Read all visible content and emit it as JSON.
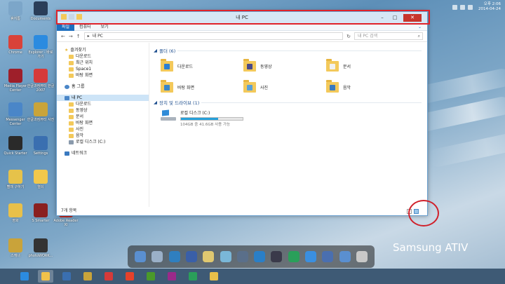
{
  "desktop": {
    "icons": [
      {
        "label": "휴지통",
        "color": "#7ca6c9"
      },
      {
        "label": "Documents",
        "color": "#2a3e59"
      },
      {
        "label": "Chrome",
        "color": "#d9423a"
      },
      {
        "label": "Explorer - 바로 가기",
        "color": "#2b8be0"
      },
      {
        "label": "Media Player Center",
        "color": "#9e1f2a"
      },
      {
        "label": "한글과컴퓨터 한글 2007",
        "color": "#d63a3a"
      },
      {
        "label": "Messenger Center",
        "color": "#4a86c8"
      },
      {
        "label": "한글과컴퓨터 사전",
        "color": "#c9a43a"
      },
      {
        "label": "Quick Starter",
        "color": "#2a2a2a"
      },
      {
        "label": "Settings",
        "color": "#3a6fb0"
      },
      {
        "label": "빨래 구하기",
        "color": "#e6c24a"
      },
      {
        "label": "열쇠",
        "color": "#f2c84b"
      },
      {
        "label": "영화",
        "color": "#e8c04a"
      },
      {
        "label": "S Smarter",
        "color": "#8a2020"
      },
      {
        "label": "Adobe Reader XI",
        "color": "#c3281e"
      },
      {
        "label": "스캐너",
        "color": "#c9a33a"
      },
      {
        "label": "photoWORK...",
        "color": "#333333"
      }
    ]
  },
  "window": {
    "title": "내 PC",
    "tabs": [
      "파일",
      "컴퓨터",
      "보기"
    ],
    "address": [
      "▸",
      "내 PC"
    ],
    "search_placeholder": "내 PC 검색",
    "nav": {
      "favorites_header": "즐겨찾기",
      "favorites": [
        "다운로드",
        "최근 위치",
        "Space1",
        "바탕 화면"
      ],
      "homegroup": "홈 그룹",
      "thispc": "내 PC",
      "thispc_items": [
        "다운로드",
        "동영상",
        "문서",
        "바탕 화면",
        "사진",
        "음악",
        "로컬 디스크 (C:)"
      ],
      "network": "네트워크"
    },
    "folders_header": "폴더 (6)",
    "folders": [
      {
        "label": "다운로드",
        "overlay": "#2b7fd4"
      },
      {
        "label": "동영상",
        "overlay": "#4a4a8a"
      },
      {
        "label": "문서",
        "overlay": "#f1f1f1"
      },
      {
        "label": "바탕 화면",
        "overlay": "#3a86c8"
      },
      {
        "label": "사진",
        "overlay": "#5aa0d8"
      },
      {
        "label": "음악",
        "overlay": "#3a7ac0"
      }
    ],
    "drives_header": "장치 및 드라이브 (1)",
    "drive": {
      "name": "로컬 디스크 (C:)",
      "size_text": "104GB 중 41.6GB 사용 가능",
      "used_fraction": 0.6
    },
    "status": "7개 항목"
  },
  "dock_colors": [
    "#5a8fd0",
    "#9ab0c8",
    "#2f7fbf",
    "#3a5fa8",
    "#e0c870",
    "#7ab7d8",
    "#5a6f8a",
    "#2a7fc7",
    "#3a3a4a",
    "#2a9f5a",
    "#3a8fe0",
    "#4a6fb0",
    "#5a8fd0",
    "#c8c8c8"
  ],
  "brand": "Samsung ATIV",
  "taskbar_colors": [
    "#2b8be0",
    "#f1c24a",
    "#3a6fb0",
    "#c9a43a",
    "#d63a3a",
    "#e6412b",
    "#4a9a2a",
    "#9a2a8a",
    "#2a9f5a",
    "#e8c04a"
  ],
  "clock": {
    "time": "오후 2:06",
    "date": "2014-04-24"
  }
}
